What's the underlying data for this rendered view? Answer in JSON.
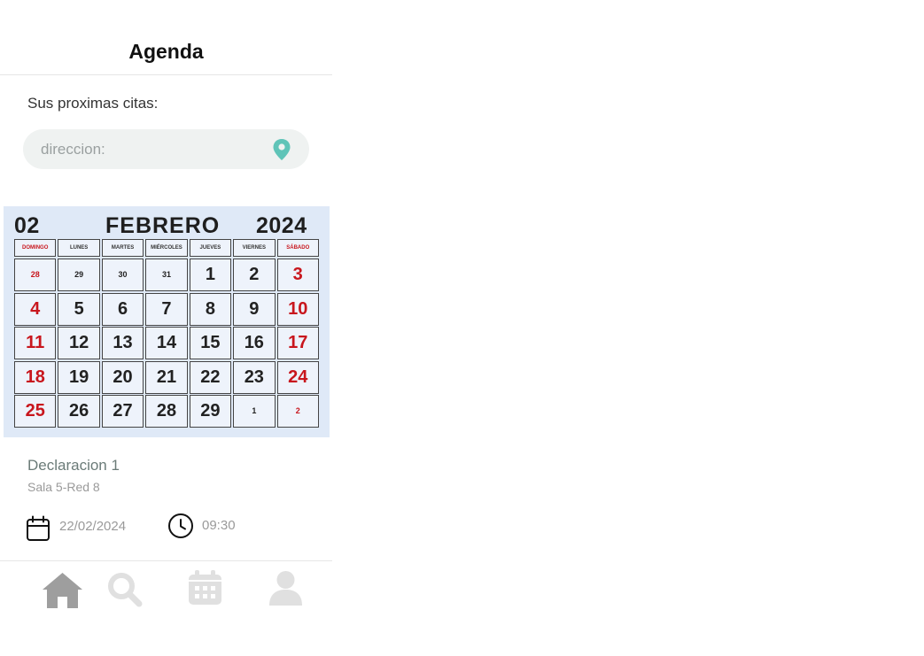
{
  "header": {
    "title": "Agenda"
  },
  "upcoming": {
    "label": "Sus proximas citas:"
  },
  "search": {
    "placeholder": "direccion:",
    "value": ""
  },
  "calendar": {
    "month_number": "02",
    "month_name": "FEBRERO",
    "year": "2024",
    "weekdays": [
      "DOMINGO",
      "LUNES",
      "MARTES",
      "MIÉRCOLES",
      "JUEVES",
      "VIERNES",
      "SÁBADO"
    ],
    "weeks": [
      [
        "28",
        "29",
        "30",
        "31",
        "1",
        "2",
        "3"
      ],
      [
        "4",
        "5",
        "6",
        "7",
        "8",
        "9",
        "10"
      ],
      [
        "11",
        "12",
        "13",
        "14",
        "15",
        "16",
        "17"
      ],
      [
        "18",
        "19",
        "20",
        "21",
        "22",
        "23",
        "24"
      ],
      [
        "25",
        "26",
        "27",
        "28",
        "29",
        "1",
        "2"
      ]
    ]
  },
  "appointment": {
    "title": "Declaracion 1",
    "place": "Sala 5-Red 8",
    "date": "22/02/2024",
    "time": "09:30"
  },
  "nav": {
    "items": [
      {
        "icon": "home-icon",
        "active": true
      },
      {
        "icon": "search-icon",
        "active": false
      },
      {
        "icon": "calendar-icon",
        "active": false
      },
      {
        "icon": "user-icon",
        "active": false
      }
    ]
  },
  "colors": {
    "accent": "#5fc4b8",
    "weekend_red": "#c8161d",
    "calendar_bg": "#dfe9f7",
    "nav_active": "#9e9e9e",
    "nav_inactive": "#e0e0e0"
  }
}
